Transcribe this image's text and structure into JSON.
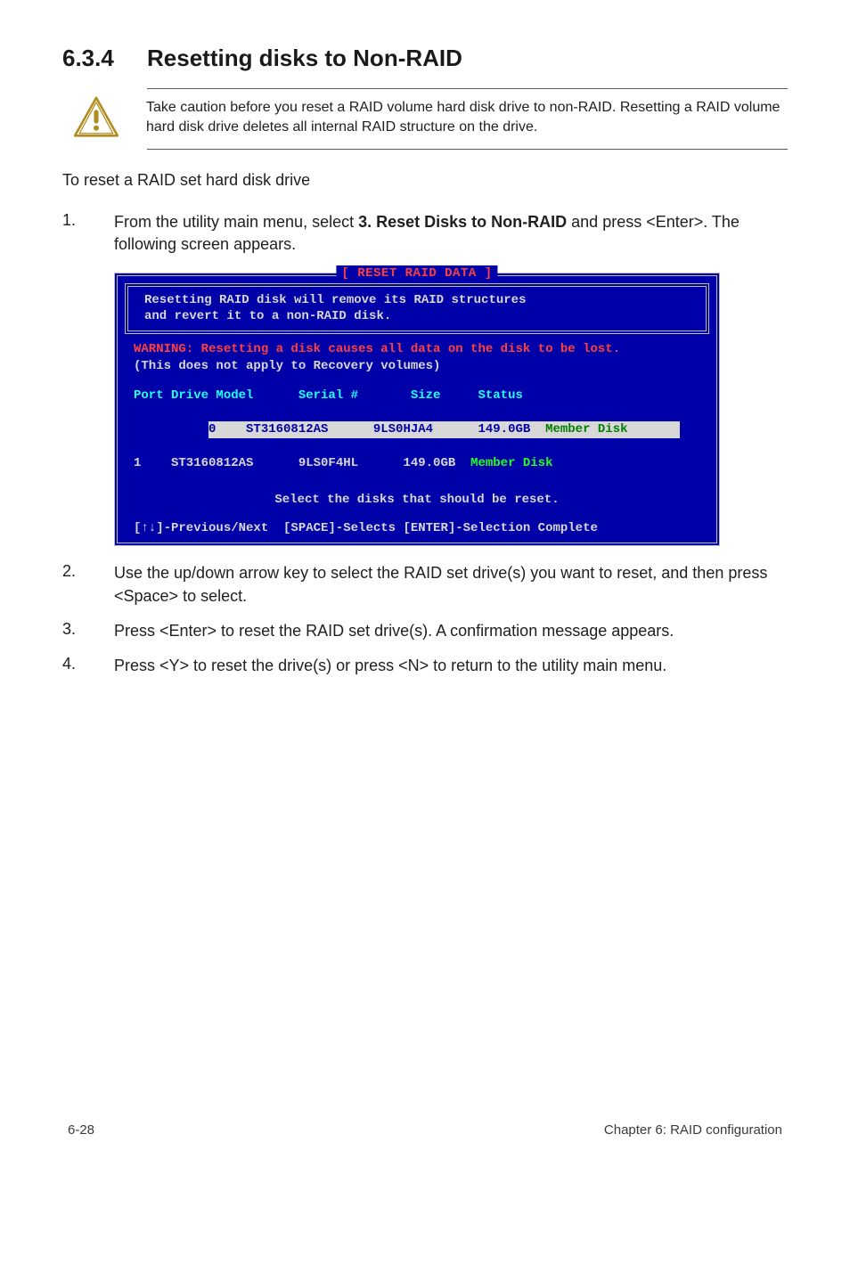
{
  "heading": {
    "num": "6.3.4",
    "title": "Resetting disks to Non-RAID"
  },
  "caution": {
    "text": "Take caution before you reset a RAID volume hard disk drive to non-RAID. Resetting a RAID volume hard disk drive deletes all internal RAID structure on the drive."
  },
  "intro": "To reset a RAID set hard disk drive",
  "steps": {
    "s1": {
      "num": "1.",
      "pre": "From the utility main menu, select ",
      "bold": "3. Reset Disks to Non-RAID",
      "post": " and press <Enter>. The following screen appears."
    },
    "s2": {
      "num": "2.",
      "text": "Use the up/down arrow key to select the RAID set drive(s) you want to reset, and then press <Space> to select."
    },
    "s3": {
      "num": "3.",
      "text": "Press <Enter> to reset the RAID set drive(s). A confirmation message appears."
    },
    "s4": {
      "num": "4.",
      "text": "Press <Y> to reset the drive(s) or press <N> to return to the utility main menu."
    }
  },
  "bios": {
    "title": "[ RESET RAID DATA ]",
    "line1": "Resetting RAID disk will remove its RAID structures",
    "line2": "and revert it to a non-RAID disk.",
    "warning": "WARNING: Resetting a disk causes all data on the disk to be lost.",
    "recovery": "(This does not apply to Recovery volumes)",
    "header_row": "Port Drive Model      Serial #       Size     Status",
    "row0_pre": "0    ST3160812AS      9LS0HJA4      149.0GB  ",
    "row0_status": "Member Disk       ",
    "row1_pre": "1    ST3160812AS      9LS0F4HL      149.0GB  ",
    "row1_status": "Member Disk",
    "select_line": "Select the disks that should be reset.",
    "footer_line": "[↑↓]-Previous/Next  [SPACE]-Selects [ENTER]-Selection Complete"
  },
  "footer": {
    "left": "6-28",
    "right": "Chapter 6: RAID configuration"
  }
}
